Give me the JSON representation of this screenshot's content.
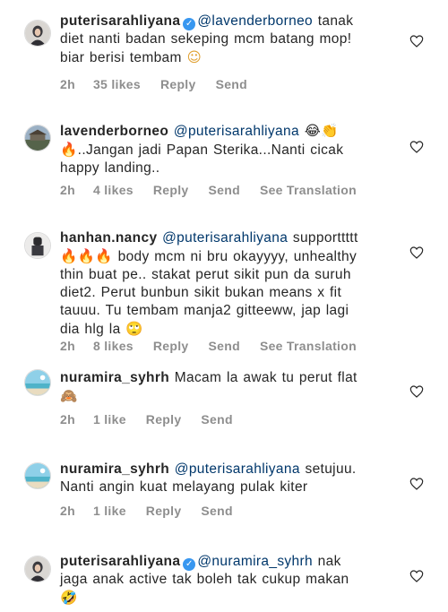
{
  "comments": [
    {
      "username": "puterisarahliyana",
      "verified": true,
      "mention": "@lavenderborneo",
      "text_a": " tanak",
      "text_b": "diet nanti badan sekeping mcm batang mop!",
      "text_c": "biar berisi tembam ",
      "emoji_end": "☺",
      "time": "2h",
      "likes": "35 likes",
      "reply": "Reply",
      "send": "Send"
    },
    {
      "username": "lavenderborneo",
      "mention": "@puterisarahliyana",
      "emoji_after_mention": "😂👏",
      "emoji_start": "🔥",
      "text_a": "..Jangan jadi Papan Sterika...Nanti cicak",
      "text_b": "happy landing..",
      "time": "2h",
      "likes": "4 likes",
      "reply": "Reply",
      "send": "Send",
      "translate": "See Translation"
    },
    {
      "username": "hanhan.nancy",
      "mention": "@puterisarahliyana",
      "text_a": " supporttttt",
      "emoji_start": "🔥🔥🔥",
      "text_b": " body mcm ni bru okayyyy, unhealthy",
      "text_c": "thin buat pe.. stakat perut sikit pun da suruh",
      "text_d": "diet2. Perut bunbun sikit bukan means x fit",
      "text_e": "tauuu. Tu tembam manja2 gitteeww, jap lagi",
      "text_f": "dia hlg la ",
      "emoji_end": "🙄",
      "time": "2h",
      "likes": "8 likes",
      "reply": "Reply",
      "send": "Send",
      "translate": "See Translation"
    },
    {
      "username": "nuramira_syhrh",
      "text_a": " Macam la awak tu perut flat",
      "emoji_end": "🙈",
      "time": "2h",
      "likes": "1 like",
      "reply": "Reply",
      "send": "Send"
    },
    {
      "username": "nuramira_syhrh",
      "mention": "@puterisarahliyana",
      "text_a": " setujuu.",
      "text_b": "Nanti angin kuat melayang pulak kiter",
      "time": "2h",
      "likes": "1 like",
      "reply": "Reply",
      "send": "Send"
    },
    {
      "username": "puterisarahliyana",
      "verified": true,
      "mention": "@nuramira_syhrh",
      "text_a": " nak",
      "text_b": "jaga anak active tak boleh tak cukup makan",
      "emoji_end": "🤣"
    }
  ],
  "icons": {
    "verified": "verified-badge-icon",
    "like": "heart-icon"
  },
  "colors": {
    "text": "#262626",
    "meta": "#8e8e8e",
    "mention": "#00376b",
    "verified": "#3897f0"
  }
}
